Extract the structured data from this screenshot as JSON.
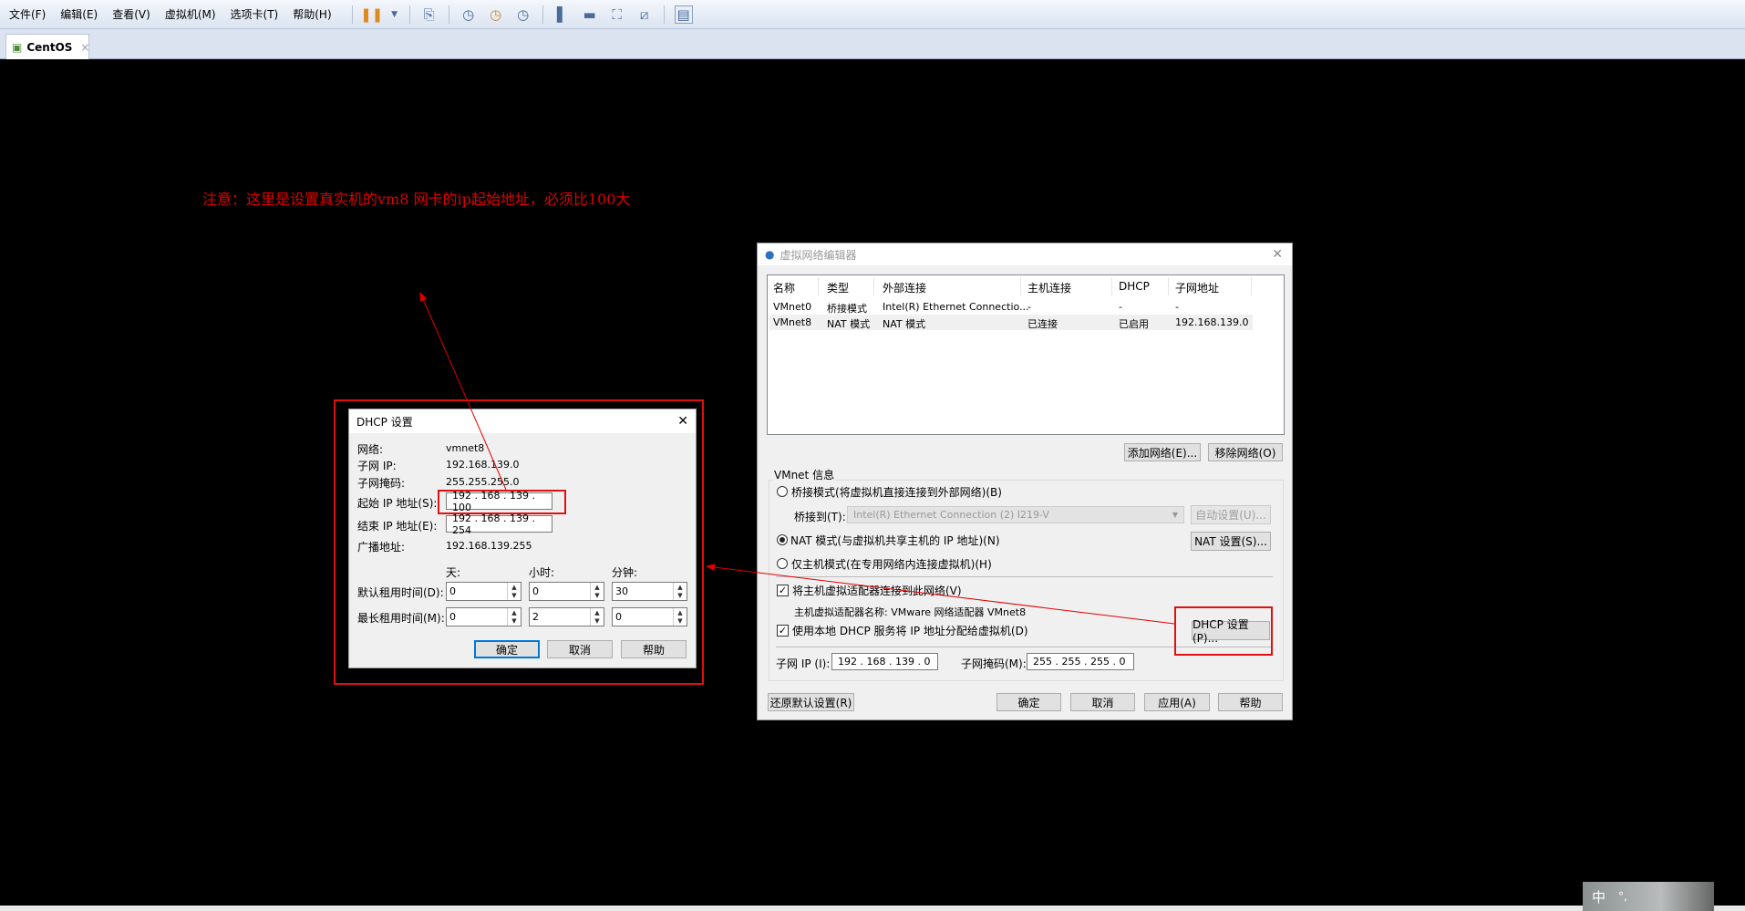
{
  "menubar": {
    "items": [
      "文件(F)",
      "编辑(E)",
      "查看(V)",
      "虚拟机(M)",
      "选项卡(T)",
      "帮助(H)"
    ]
  },
  "toolbar": {
    "icons": [
      "pause-icon",
      "dropdown-icon",
      "send-keys-icon",
      "snapshot-icon",
      "revert-snapshot-icon",
      "snapshot-manager-icon",
      "sidebar-icon",
      "console-icon",
      "fullscreen-icon",
      "unity-icon",
      "thumbnail-icon"
    ]
  },
  "tab": {
    "label": "CentOS",
    "close": "×"
  },
  "annotation": "注意：这里是设置真实机的vm8 网卡的ip起始地址，必须比100大",
  "vne": {
    "title": "虚拟网络编辑器",
    "columns": [
      "名称",
      "类型",
      "外部连接",
      "主机连接",
      "DHCP",
      "子网地址"
    ],
    "rows": [
      [
        "VMnet0",
        "桥接模式",
        "Intel(R) Ethernet Connectio...",
        "-",
        "-",
        "-"
      ],
      [
        "VMnet8",
        "NAT 模式",
        "NAT 模式",
        "已连接",
        "已启用",
        "192.168.139.0"
      ]
    ],
    "add_network": "添加网络(E)...",
    "remove_network": "移除网络(O)",
    "group": "VMnet 信息",
    "bridged": "桥接模式(将虚拟机直接连接到外部网络)(B)",
    "bridge_to_label": "桥接到(T):",
    "bridge_to_value": "Intel(R) Ethernet Connection (2) I219-V",
    "auto_settings": "自动设置(U)...",
    "nat": "NAT 模式(与虚拟机共享主机的 IP 地址)(N)",
    "nat_settings": "NAT 设置(S)...",
    "host_only": "仅主机模式(在专用网络内连接虚拟机)(H)",
    "connect_adapter": "将主机虚拟适配器连接到此网络(V)",
    "adapter_name": "主机虚拟适配器名称: VMware 网络适配器 VMnet8",
    "use_dhcp": "使用本地 DHCP 服务将 IP 地址分配给虚拟机(D)",
    "dhcp_settings": "DHCP 设置(P)...",
    "subnet_ip_label": "子网 IP (I):",
    "subnet_ip": "192 . 168 . 139 . 0",
    "subnet_mask_label": "子网掩码(M):",
    "subnet_mask": "255 . 255 . 255 . 0",
    "restore": "还原默认设置(R)",
    "ok": "确定",
    "cancel": "取消",
    "apply": "应用(A)",
    "help": "帮助"
  },
  "dhcp": {
    "title": "DHCP 设置",
    "close": "✕",
    "network_label": "网络:",
    "network": "vmnet8",
    "subnet_ip_label": "子网 IP:",
    "subnet_ip": "192.168.139.0",
    "subnet_mask_label": "子网掩码:",
    "subnet_mask": "255.255.255.0",
    "start_label": "起始 IP 地址(S):",
    "start": "192 . 168 . 139 . 100",
    "end_label": "结束 IP 地址(E):",
    "end": "192 . 168 . 139 . 254",
    "broadcast_label": "广播地址:",
    "broadcast": "192.168.139.255",
    "days": "天:",
    "hours": "小时:",
    "minutes": "分钟:",
    "default_lease_label": "默认租用时间(D):",
    "default_lease": [
      "0",
      "0",
      "30"
    ],
    "max_lease_label": "最长租用时间(M):",
    "max_lease": [
      "0",
      "2",
      "0"
    ],
    "ok": "确定",
    "cancel": "取消",
    "help": "帮助"
  },
  "ime": {
    "label": "中",
    "punct": "°,"
  },
  "colors": {
    "annotation": "#e00000",
    "accent": "#0078d7"
  }
}
